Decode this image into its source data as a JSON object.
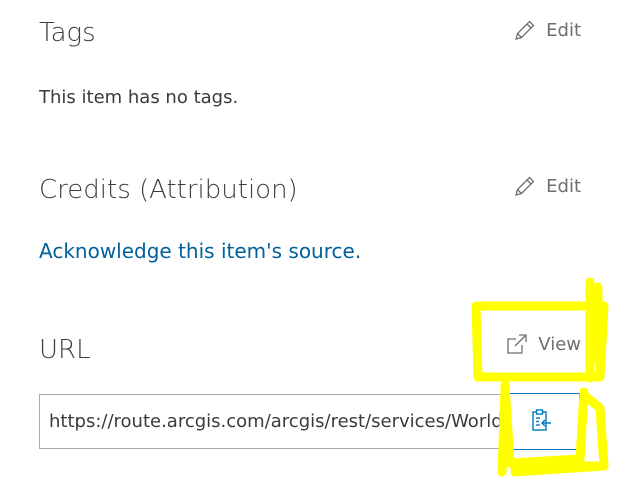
{
  "tags": {
    "title": "Tags",
    "edit_label": "Edit",
    "empty_text": "This item has no tags."
  },
  "credits": {
    "title": "Credits (Attribution)",
    "edit_label": "Edit",
    "link_text": "Acknowledge this item's source."
  },
  "url": {
    "title": "URL",
    "view_label": "View",
    "value": "https://route.arcgis.com/arcgis/rest/services/World/Route/NAServer/Route_World",
    "copy_icon": "clipboard-copy-icon"
  },
  "colors": {
    "link": "#00619b",
    "copy_border": "#0079c1",
    "highlight": "#ffff00"
  }
}
